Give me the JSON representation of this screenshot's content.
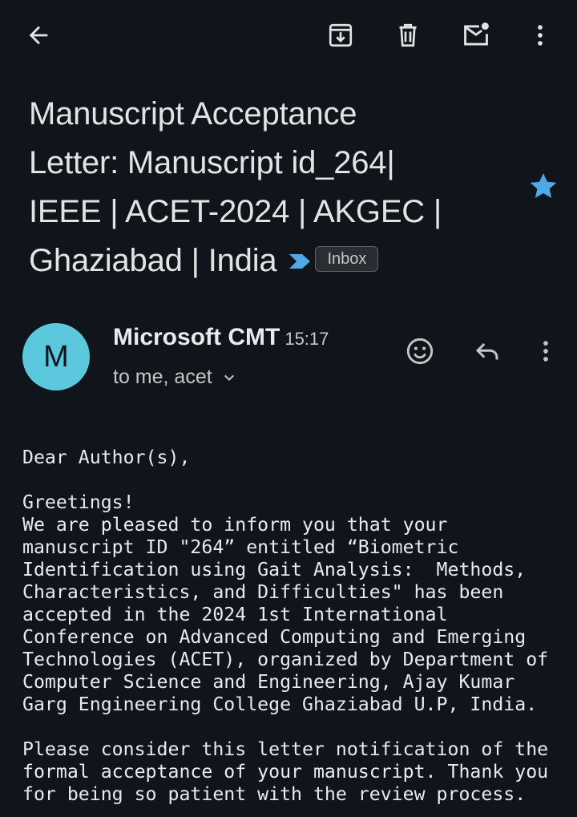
{
  "toolbar": {
    "icons": [
      "arrow-back-icon",
      "archive-icon",
      "delete-icon",
      "mark-unread-icon",
      "more-vert-icon"
    ]
  },
  "email": {
    "subject_lines": [
      "Manuscript Acceptance",
      "Letter: Manuscript id_264|",
      "IEEE | ACET-2024 | AKGEC |",
      "Ghaziabad | India"
    ],
    "label": "Inbox",
    "starred": true,
    "sender": {
      "initial": "M",
      "name": "Microsoft CMT",
      "time": "15:17",
      "recipients": "to me, acet"
    },
    "body": "Dear Author(s),\n\nGreetings!\nWe are pleased to inform you that your\nmanuscript ID \"264” entitled “Biometric\nIdentification using Gait Analysis:  Methods,\nCharacteristics, and Difficulties\" has been\naccepted in the 2024 1st International\nConference on Advanced Computing and Emerging\nTechnologies (ACET), organized by Department of\nComputer Science and Engineering, Ajay Kumar\nGarg Engineering College Ghaziabad U.P, India.\n\nPlease consider this letter notification of the\nformal acceptance of your manuscript. Thank you\nfor being so patient with the review process."
  },
  "colors": {
    "background": "#10151c",
    "avatar": "#5bc8de",
    "star": "#4fa9e8",
    "importance_marker": "#4fa9e8"
  }
}
